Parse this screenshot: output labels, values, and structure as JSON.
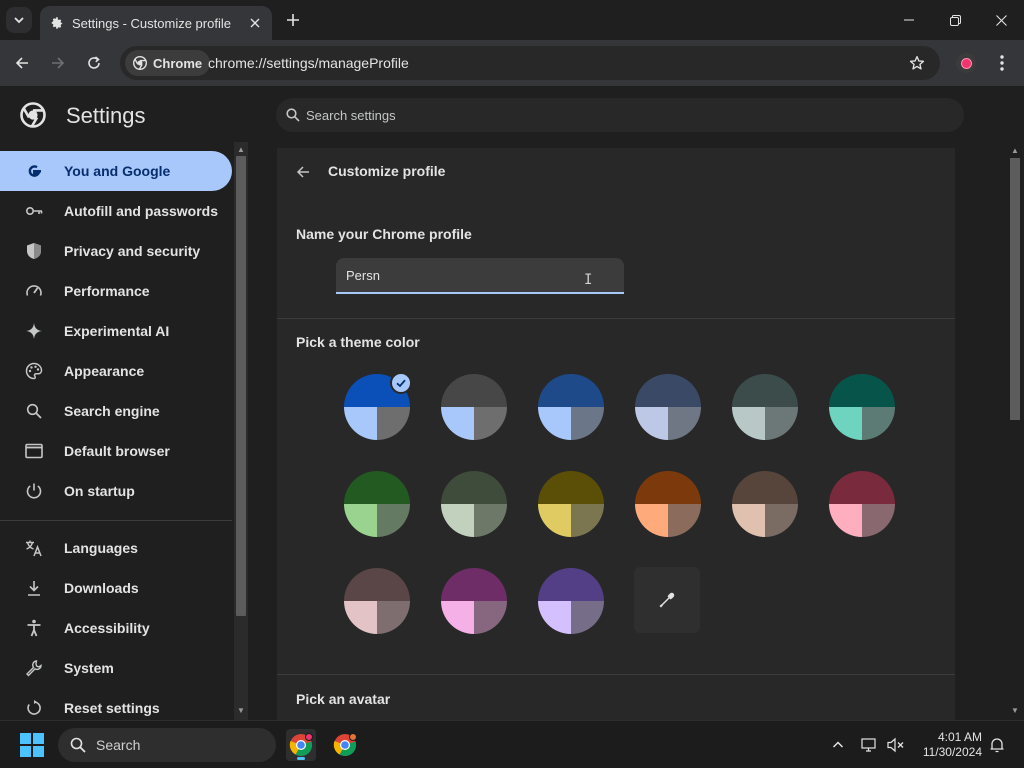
{
  "browser": {
    "tab_title": "Settings - Customize profile",
    "omnibox_chip": "Chrome",
    "url": "chrome://settings/manageProfile",
    "profile_color": "#f0346f"
  },
  "settings": {
    "title": "Settings",
    "search_placeholder": "Search settings"
  },
  "sidebar": {
    "items": [
      {
        "label": "You and Google",
        "icon": "google-g-icon",
        "active": true
      },
      {
        "label": "Autofill and passwords",
        "icon": "key-icon"
      },
      {
        "label": "Privacy and security",
        "icon": "shield-icon"
      },
      {
        "label": "Performance",
        "icon": "speedometer-icon"
      },
      {
        "label": "Experimental AI",
        "icon": "sparkle-icon"
      },
      {
        "label": "Appearance",
        "icon": "palette-icon"
      },
      {
        "label": "Search engine",
        "icon": "search-icon"
      },
      {
        "label": "Default browser",
        "icon": "browser-window-icon"
      },
      {
        "label": "On startup",
        "icon": "power-icon"
      },
      {
        "label": "Languages",
        "icon": "translate-icon"
      },
      {
        "label": "Downloads",
        "icon": "download-icon"
      },
      {
        "label": "Accessibility",
        "icon": "accessibility-icon"
      },
      {
        "label": "System",
        "icon": "wrench-icon"
      },
      {
        "label": "Reset settings",
        "icon": "reset-icon"
      }
    ]
  },
  "main": {
    "page_title": "Customize profile",
    "name_label": "Name your Chrome profile",
    "name_value": "Persn",
    "theme_label": "Pick a theme color",
    "avatar_label": "Pick an avatar",
    "theme_colors": [
      {
        "top": "#0b50b8",
        "bl": "#a8c7fa",
        "br": "#6e6e6e",
        "selected": true
      },
      {
        "top": "#474747",
        "bl": "#a8c7fa",
        "br": "#6e6e6e"
      },
      {
        "top": "#1e4a8a",
        "bl": "#a8c7fa",
        "br": "#6b7689"
      },
      {
        "top": "#3a4a66",
        "bl": "#bcc8e6",
        "br": "#6f7684"
      },
      {
        "top": "#3b4c4b",
        "bl": "#b7c8c7",
        "br": "#6c7877"
      },
      {
        "top": "#07554a",
        "bl": "#6ed4bf",
        "br": "#5c7b74"
      },
      {
        "top": "#235a22",
        "bl": "#9ad38f",
        "br": "#657a62"
      },
      {
        "top": "#3f4c3c",
        "bl": "#c2d1bd",
        "br": "#6d7869"
      },
      {
        "top": "#5b4e06",
        "bl": "#e0cb63",
        "br": "#7c7650"
      },
      {
        "top": "#7c3a0c",
        "bl": "#ffaa7a",
        "br": "#8a6b5c"
      },
      {
        "top": "#57443a",
        "bl": "#e0c0ae",
        "br": "#7a6b63"
      },
      {
        "top": "#7a2a3d",
        "bl": "#ffaec0",
        "br": "#8a6870"
      },
      {
        "top": "#5a4547",
        "bl": "#e3c3c6",
        "br": "#7e6e70"
      },
      {
        "top": "#6e2d66",
        "bl": "#f4b0e7",
        "br": "#86677f"
      },
      {
        "top": "#533f86",
        "bl": "#d5c0ff",
        "br": "#766d88"
      }
    ]
  },
  "taskbar": {
    "search_label": "Search",
    "time": "4:01 AM",
    "date": "11/30/2024"
  }
}
